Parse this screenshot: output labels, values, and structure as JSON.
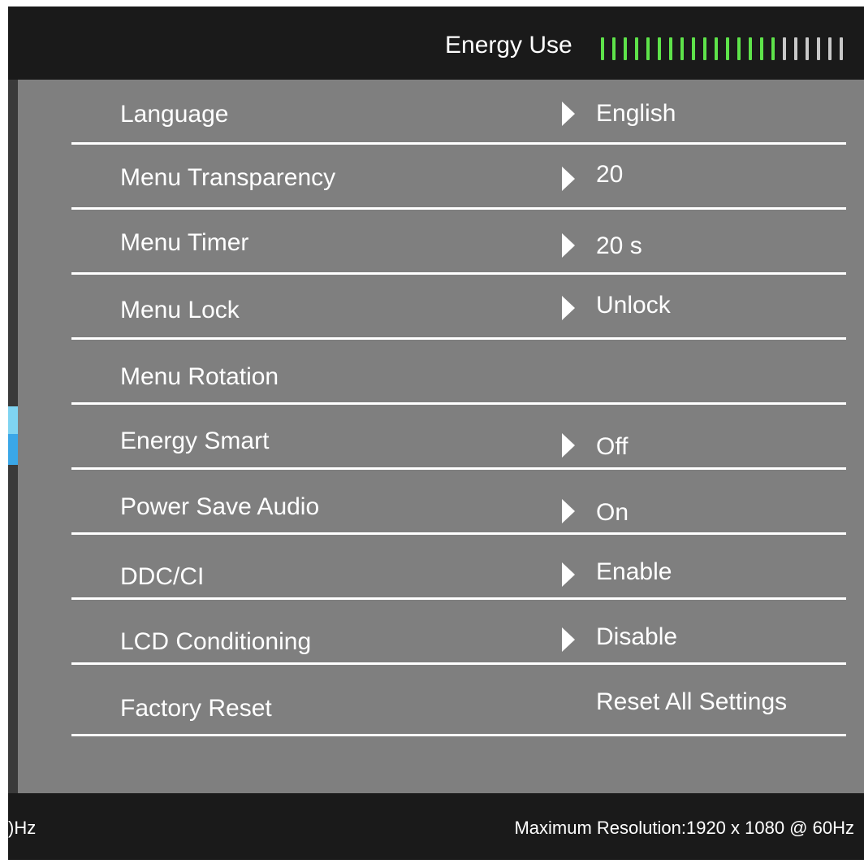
{
  "header": {
    "energy_label": "Energy Use",
    "energy_level": {
      "filled": 16,
      "total": 22
    },
    "colors": {
      "filled": "#5ee34a",
      "empty": "#c8c8c8"
    }
  },
  "menu": {
    "items": [
      {
        "label": "Language",
        "value": "English",
        "has_arrow": true
      },
      {
        "label": "Menu Transparency",
        "value": "20",
        "has_arrow": true
      },
      {
        "label": "Menu Timer",
        "value": "20 s",
        "has_arrow": true
      },
      {
        "label": "Menu Lock",
        "value": "Unlock",
        "has_arrow": true
      },
      {
        "label": "Menu Rotation",
        "value": "",
        "has_arrow": false
      },
      {
        "label": "Energy Smart",
        "value": "Off",
        "has_arrow": true
      },
      {
        "label": "Power Save Audio",
        "value": "On",
        "has_arrow": true
      },
      {
        "label": "DDC/CI",
        "value": "Enable",
        "has_arrow": true
      },
      {
        "label": "LCD Conditioning",
        "value": "Disable",
        "has_arrow": true
      },
      {
        "label": "Factory Reset",
        "value": "Reset All Settings",
        "has_arrow": false
      }
    ]
  },
  "footer": {
    "left_text": ")Hz",
    "max_resolution": "Maximum Resolution:1920 x 1080 @ 60Hz"
  },
  "colors": {
    "panel": "#7f7f7f",
    "frame": "#1a1a1a",
    "accent": "#3aa7e8"
  }
}
